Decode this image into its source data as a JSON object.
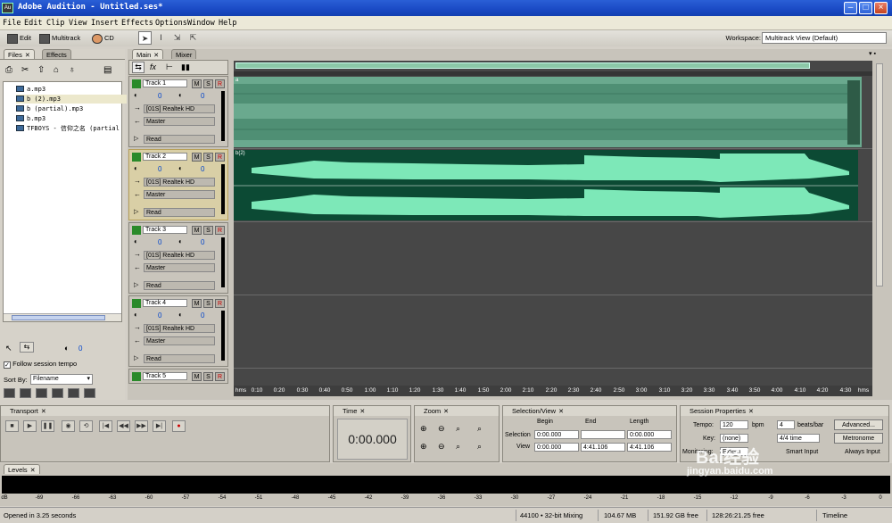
{
  "app_title": "Adobe Audition - Untitled.ses*",
  "app_icon": "Au",
  "menu": [
    "File",
    "Edit",
    "Clip",
    "View",
    "Insert",
    "Effects",
    "Options",
    "Window",
    "Help"
  ],
  "toolbar": {
    "edit": "Edit",
    "multitrack": "Multitrack",
    "cd": "CD",
    "workspace_label": "Workspace:",
    "workspace_value": "Multitrack View (Default)"
  },
  "files_panel": {
    "tabs": [
      "Files",
      "Effects"
    ],
    "files": [
      "a.mp3",
      "b (2).mp3",
      "b (partial).mp3",
      "b.mp3",
      "TFBOYS - 信仰之名 (partial"
    ],
    "follow_tempo": "Follow session tempo",
    "sort_by_label": "Sort By:",
    "sort_by_value": "Filename",
    "vol_value": "0"
  },
  "main_tabs": [
    "Main",
    "Mixer"
  ],
  "tracks": [
    {
      "name": "Track 1",
      "input": "[01S] Realtek HD",
      "output": "Master",
      "mode": "Read",
      "vol": "0",
      "pan": "0"
    },
    {
      "name": "Track 2",
      "input": "[01S] Realtek HD",
      "output": "Master",
      "mode": "Read",
      "vol": "0",
      "pan": "0"
    },
    {
      "name": "Track 3",
      "input": "[01S] Realtek HD",
      "output": "Master",
      "mode": "Read",
      "vol": "0",
      "pan": "0"
    },
    {
      "name": "Track 4",
      "input": "[01S] Realtek HD",
      "output": "Master",
      "mode": "Read",
      "vol": "0",
      "pan": "0"
    },
    {
      "name": "Track 5"
    }
  ],
  "track_buttons": {
    "mute": "M",
    "solo": "S",
    "record": "R"
  },
  "clips": {
    "clip1_label": "a",
    "clip2_label": "b(2)"
  },
  "ruler": [
    "hms",
    "0:10",
    "0:20",
    "0:30",
    "0:40",
    "0:50",
    "1:00",
    "1:10",
    "1:20",
    "1:30",
    "1:40",
    "1:50",
    "2:00",
    "2:10",
    "2:20",
    "2:30",
    "2:40",
    "2:50",
    "3:00",
    "3:10",
    "3:20",
    "3:30",
    "3:40",
    "3:50",
    "4:00",
    "4:10",
    "4:20",
    "4:30",
    "hms"
  ],
  "transport": {
    "title": "Transport"
  },
  "time": {
    "title": "Time",
    "value": "0:00.000"
  },
  "zoom": {
    "title": "Zoom"
  },
  "selection": {
    "title": "Selection/View",
    "begin": "Begin",
    "end": "End",
    "length": "Length",
    "selection_label": "Selection",
    "view_label": "View",
    "sel_begin": "0:00.000",
    "sel_end": "",
    "sel_length": "0:00.000",
    "view_begin": "0:00.000",
    "view_end": "4:41.106",
    "view_length": "4:41.106"
  },
  "session": {
    "title": "Session Properties",
    "tempo_label": "Tempo:",
    "tempo": "120",
    "bpm": "bpm",
    "beats": "4",
    "beats_label": "beats/bar",
    "advanced": "Advanced...",
    "key_label": "Key:",
    "key": "(none)",
    "time_sig": "4/4 time",
    "metronome": "Metronome",
    "monitoring_label": "Monitoring:",
    "monitoring": "Extern",
    "smart_input": "Smart Input",
    "always_input": "Always Input"
  },
  "levels": {
    "title": "Levels",
    "scale": [
      "dB",
      "-69",
      "-66",
      "-63",
      "-60",
      "-57",
      "-54",
      "-51",
      "-48",
      "-45",
      "-42",
      "-39",
      "-36",
      "-33",
      "-30",
      "-27",
      "-24",
      "-21",
      "-18",
      "-15",
      "-12",
      "-9",
      "-6",
      "-3",
      "0"
    ]
  },
  "status": {
    "opened": "Opened in 3.25 seconds",
    "format": "44100 • 32-bit Mixing",
    "mem": "104.67 MB",
    "free": "151.92 GB free",
    "time_free": "128:26:21.25 free",
    "view": "Timeline"
  },
  "watermark": {
    "brand": "Bai经验",
    "url": "jingyan.baidu.com"
  },
  "colors": {
    "titlebar": "#1a49c4",
    "clip1": "#6aa98e",
    "clip2_bg": "#0c4a34",
    "clip2_wave": "#7de8b8",
    "lane": "#474747"
  }
}
